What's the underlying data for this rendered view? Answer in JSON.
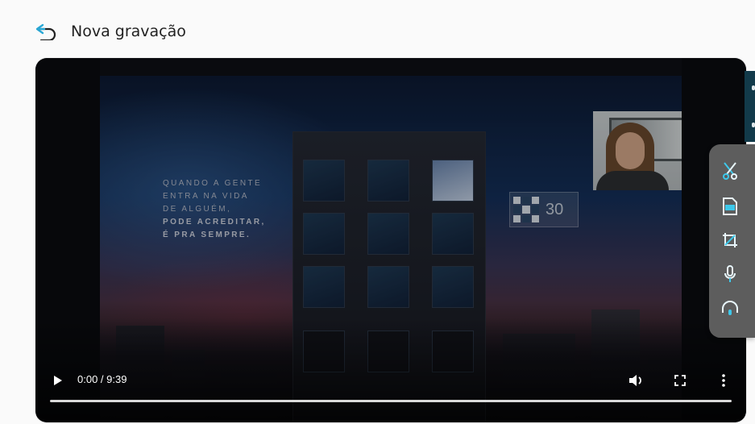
{
  "header": {
    "title": "Nova gravação",
    "back_icon": "back-arrow-icon",
    "back_color": "#29a8d6"
  },
  "player": {
    "time_display": "0:00 / 9:39",
    "progress": 0.0,
    "controls": [
      "play-icon",
      "volume-icon",
      "fullscreen-icon",
      "more-options-icon"
    ]
  },
  "video_content": {
    "quote_lines": [
      "QUANDO A GENTE",
      "ENTRA NA VIDA",
      "DE ALGUÉM,"
    ],
    "quote_bold_lines": [
      "PODE ACREDITAR,",
      "É PRA SEMPRE."
    ],
    "logo_number": "30"
  },
  "toolbar": {
    "color": "#5d5d5d",
    "icon_color": "#3ec8ea",
    "tools": [
      "cut-icon",
      "gif-icon",
      "crop-icon",
      "microphone-icon",
      "headphones-icon"
    ]
  }
}
